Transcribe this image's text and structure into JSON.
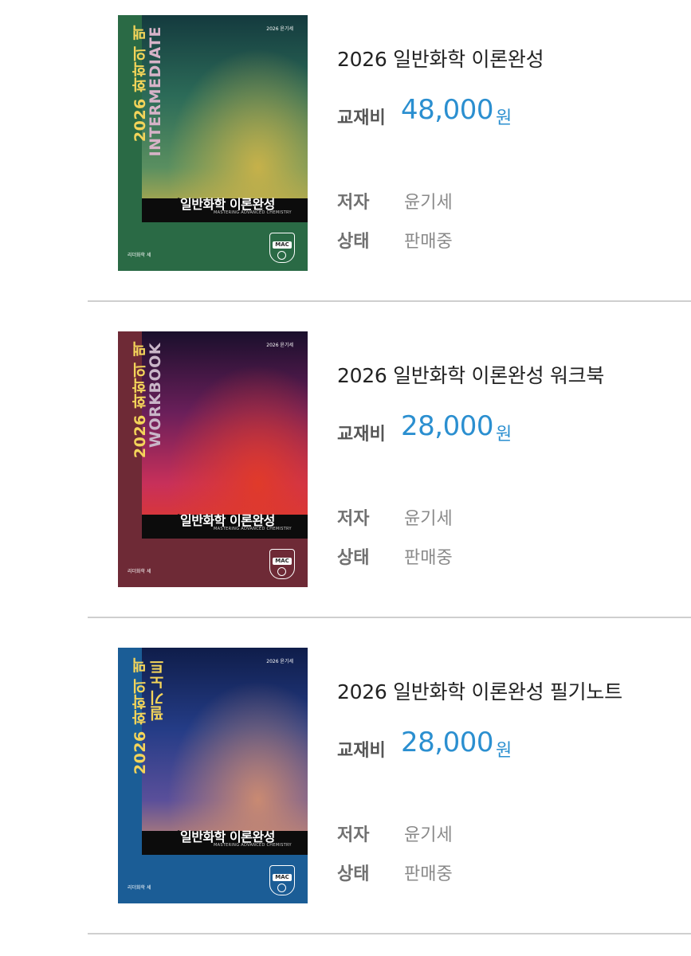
{
  "products": [
    {
      "title": "2026 일반화학 이론완성",
      "price_label": "교재비",
      "price": "48,000",
      "price_unit": "원",
      "author_label": "저자",
      "author": "윤기세",
      "status_label": "상태",
      "status": "판매중",
      "cover": {
        "vertical_title": "2026 화학의 맥",
        "vertical_subtitle": "INTERMEDIATE",
        "band_text": "일반화학 이론완성",
        "sub_text": "MASTERING ADVANCED CHEMISTRY",
        "top_text": "2026 윤기세",
        "publisher": "리더화학 세",
        "badge": "MAC",
        "spine_color": "#2a6a45",
        "sky_gradient": [
          "#143a3e",
          "#2c6b58",
          "#5a8f60",
          "#c6b14a"
        ],
        "vsub_color": "#d7b3c8"
      }
    },
    {
      "title": "2026 일반화학 이론완성 워크북",
      "price_label": "교재비",
      "price": "28,000",
      "price_unit": "원",
      "author_label": "저자",
      "author": "윤기세",
      "status_label": "상태",
      "status": "판매중",
      "cover": {
        "vertical_title": "2026 화학의 맥",
        "vertical_subtitle": "WORKBOOK",
        "band_text": "일반화학 이론완성",
        "sub_text": "MASTERING ADVANCED CHEMISTRY",
        "top_text": "2026 윤기세",
        "publisher": "리더화학 세",
        "badge": "MAC",
        "spine_color": "#6e2a36",
        "sky_gradient": [
          "#1a0f2c",
          "#6a1f5a",
          "#c8305a",
          "#e03a2a"
        ],
        "vsub_color": "#c9b6c8"
      }
    },
    {
      "title": "2026 일반화학 이론완성 필기노트",
      "price_label": "교재비",
      "price": "28,000",
      "price_unit": "원",
      "author_label": "저자",
      "author": "윤기세",
      "status_label": "상태",
      "status": "판매중",
      "cover": {
        "vertical_title": "2026 화학의 맥",
        "vertical_subtitle": "필기노트",
        "band_text": "일반화학 이론완성",
        "sub_text": "MASTERING ADVANCED CHEMISTRY",
        "top_text": "2026 윤기세",
        "publisher": "리더화학 세",
        "badge": "MAC",
        "spine_color": "#1b5d96",
        "sky_gradient": [
          "#0f1d4a",
          "#243c86",
          "#5a4f9a",
          "#c98a72"
        ],
        "vsub_color": "#f3d45a"
      }
    }
  ]
}
